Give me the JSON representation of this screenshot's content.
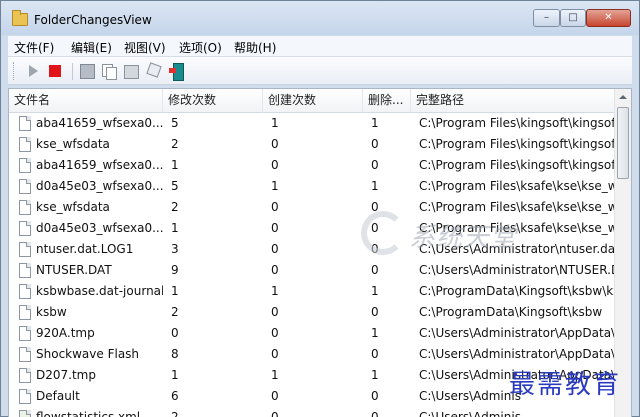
{
  "window": {
    "title": "FolderChangesView"
  },
  "titlebar": {
    "minimize": "–",
    "maximize": "□",
    "close": "✕"
  },
  "menu": [
    "文件(F)",
    "编辑(E)",
    "视图(V)",
    "选项(O)",
    "帮助(H)"
  ],
  "toolbar": {
    "icons": [
      "play-icon",
      "stop-icon",
      "save-icon",
      "copy-icon",
      "properties-icon",
      "find-icon",
      "exit-icon"
    ],
    "stop_color": "#e0141a"
  },
  "columns": [
    "文件名",
    "修改次数",
    "创建次数",
    "删除...",
    "完整路径"
  ],
  "rows": [
    {
      "name": "aba41659_wfsexa0....",
      "modified": "5",
      "created": "1",
      "deleted": "1",
      "path": "C:\\Program Files\\kingsoft\\kingsof"
    },
    {
      "name": "kse_wfsdata",
      "modified": "2",
      "created": "0",
      "deleted": "0",
      "path": "C:\\Program Files\\kingsoft\\kingsof"
    },
    {
      "name": "aba41659_wfsexa0....",
      "modified": "1",
      "created": "0",
      "deleted": "0",
      "path": "C:\\Program Files\\kingsoft\\kingsof"
    },
    {
      "name": "d0a45e03_wfsexa0....",
      "modified": "5",
      "created": "1",
      "deleted": "1",
      "path": "C:\\Program Files\\ksafe\\kse\\kse_w"
    },
    {
      "name": "kse_wfsdata",
      "modified": "2",
      "created": "0",
      "deleted": "0",
      "path": "C:\\Program Files\\ksafe\\kse\\kse_w"
    },
    {
      "name": "d0a45e03_wfsexa0....",
      "modified": "1",
      "created": "0",
      "deleted": "0",
      "path": "C:\\Program Files\\ksafe\\kse\\kse_w"
    },
    {
      "name": "ntuser.dat.LOG1",
      "modified": "3",
      "created": "0",
      "deleted": "0",
      "path": "C:\\Users\\Administrator\\ntuser.dat"
    },
    {
      "name": "NTUSER.DAT",
      "modified": "9",
      "created": "0",
      "deleted": "0",
      "path": "C:\\Users\\Administrator\\NTUSER.D"
    },
    {
      "name": "ksbwbase.dat-journal",
      "modified": "1",
      "created": "1",
      "deleted": "1",
      "path": "C:\\ProgramData\\Kingsoft\\ksbw\\ks"
    },
    {
      "name": "ksbw",
      "modified": "2",
      "created": "0",
      "deleted": "0",
      "path": "C:\\ProgramData\\Kingsoft\\ksbw"
    },
    {
      "name": "920A.tmp",
      "modified": "0",
      "created": "0",
      "deleted": "1",
      "path": "C:\\Users\\Administrator\\AppData\\"
    },
    {
      "name": "Shockwave Flash",
      "modified": "8",
      "created": "0",
      "deleted": "0",
      "path": "C:\\Users\\Administrator\\AppData\\"
    },
    {
      "name": "D207.tmp",
      "modified": "1",
      "created": "1",
      "deleted": "1",
      "path": "C:\\Users\\Administrator\\AppData\\"
    },
    {
      "name": "Default",
      "modified": "6",
      "created": "0",
      "deleted": "0",
      "path": "C:\\Users\\Adminis"
    },
    {
      "name": "flowstatistics.xml",
      "modified": "2",
      "created": "0",
      "deleted": "0",
      "path": "C:\\Users\\Adminis"
    }
  ],
  "watermarks": {
    "logo": "系统天堂",
    "stamp": "最需教育"
  }
}
